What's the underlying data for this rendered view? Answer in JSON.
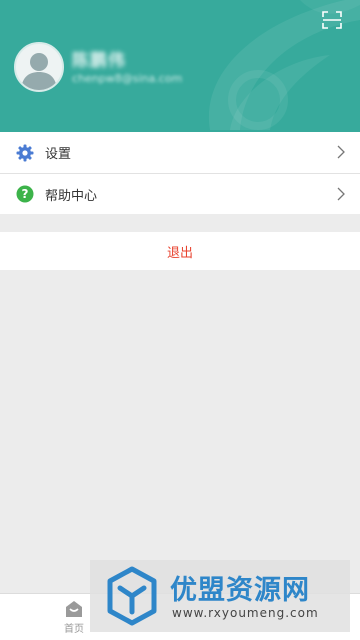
{
  "profile": {
    "name": "陈鹏伟",
    "email": "chenpw8@sina.com"
  },
  "header": {
    "scan_icon": "scan-icon",
    "color": "#37aa9c"
  },
  "menu": {
    "items": [
      {
        "label": "设置",
        "icon": "gear-icon",
        "icon_color": "#4a7bd3"
      },
      {
        "label": "帮助中心",
        "icon": "help-icon",
        "icon_color": "#3cb34a"
      }
    ]
  },
  "logout": {
    "label": "退出",
    "color": "#e8432f"
  },
  "tabbar": {
    "home_label": "首页"
  },
  "watermark": {
    "title": "优盟资源网",
    "url": "www.rxyoumeng.com",
    "color": "#2e86c9"
  }
}
